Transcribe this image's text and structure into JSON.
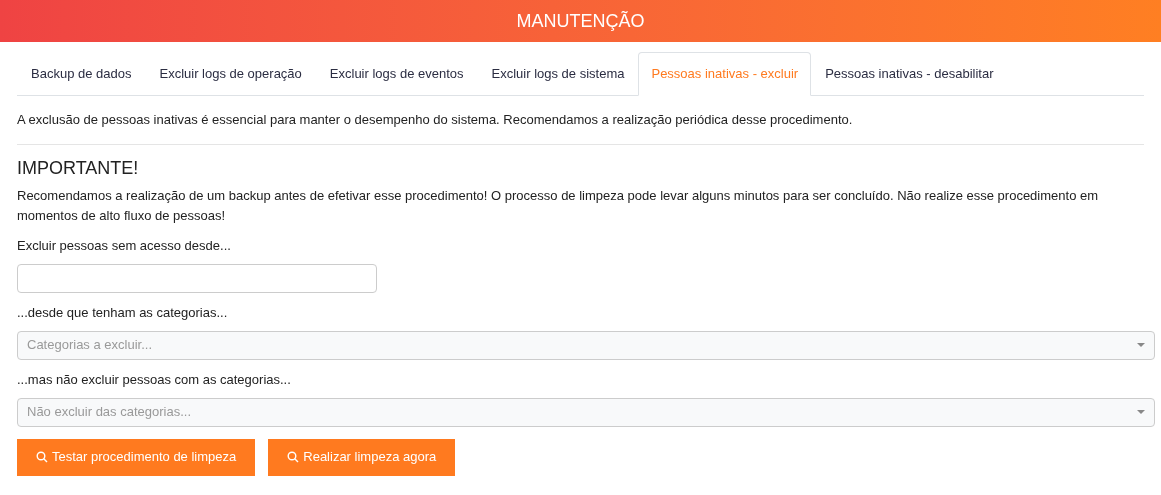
{
  "header": {
    "title": "MANUTENÇÃO"
  },
  "tabs": [
    {
      "label": "Backup de dados",
      "selected": false
    },
    {
      "label": "Excluir logs de operação",
      "selected": false
    },
    {
      "label": "Excluir logs de eventos",
      "selected": false
    },
    {
      "label": "Excluir logs de sistema",
      "selected": false
    },
    {
      "label": "Pessoas inativas - excluir",
      "selected": true
    },
    {
      "label": "Pessoas inativas - desabilitar",
      "selected": false
    }
  ],
  "intro": "A exclusão de pessoas inativas é essencial para manter o desempenho do sistema. Recomendamos a realização periódica desse procedimento.",
  "warning": {
    "title": "IMPORTANTE!",
    "text": "Recomendamos a realização de um backup antes de efetivar esse procedimento! O processo de limpeza pode levar alguns minutos para ser concluído. Não realize esse procedimento em momentos de alto fluxo de pessoas!"
  },
  "fields": [
    {
      "kind": "date",
      "label": "Excluir pessoas sem acesso desde..."
    },
    {
      "kind": "select",
      "label": "...desde que tenham as categorias...",
      "placeholder": "Categorias a excluir..."
    },
    {
      "kind": "select",
      "label": "...mas não excluir pessoas com as categorias...",
      "placeholder": "Não excluir das categorias..."
    }
  ],
  "buttons": [
    {
      "label": "Testar procedimento de limpeza"
    },
    {
      "label": "Realizar limpeza agora"
    }
  ]
}
